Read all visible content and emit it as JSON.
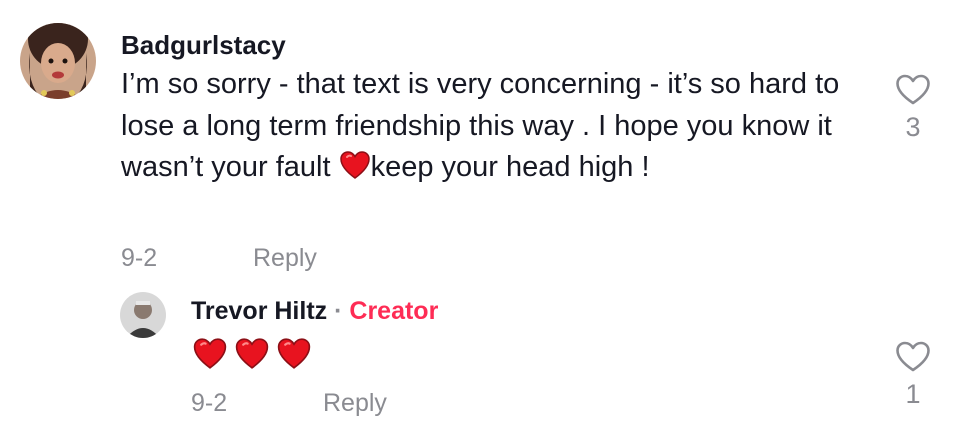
{
  "comment": {
    "username": "Badgurlstacy",
    "text_before_emoji": "I’m so sorry - that text is very concerning - it’s so hard to lose a long term friendship this way . I hope you know it wasn’t your fault ",
    "emoji": "heart-emoji",
    "text_after_emoji": "keep your head high !",
    "date": "9-2",
    "reply_label": "Reply",
    "like_count": "3",
    "like_icon": "heart-outline-icon"
  },
  "reply": {
    "username": "Trevor Hiltz",
    "separator": "·",
    "badge": "Creator",
    "emojis": [
      "heart-emoji",
      "heart-emoji",
      "heart-emoji"
    ],
    "date": "9-2",
    "reply_label": "Reply",
    "like_count": "1",
    "like_icon": "heart-outline-icon"
  },
  "colors": {
    "text": "#161823",
    "muted": "#8a8b91",
    "creator": "#fe2c55",
    "heart": "#e8131f"
  }
}
